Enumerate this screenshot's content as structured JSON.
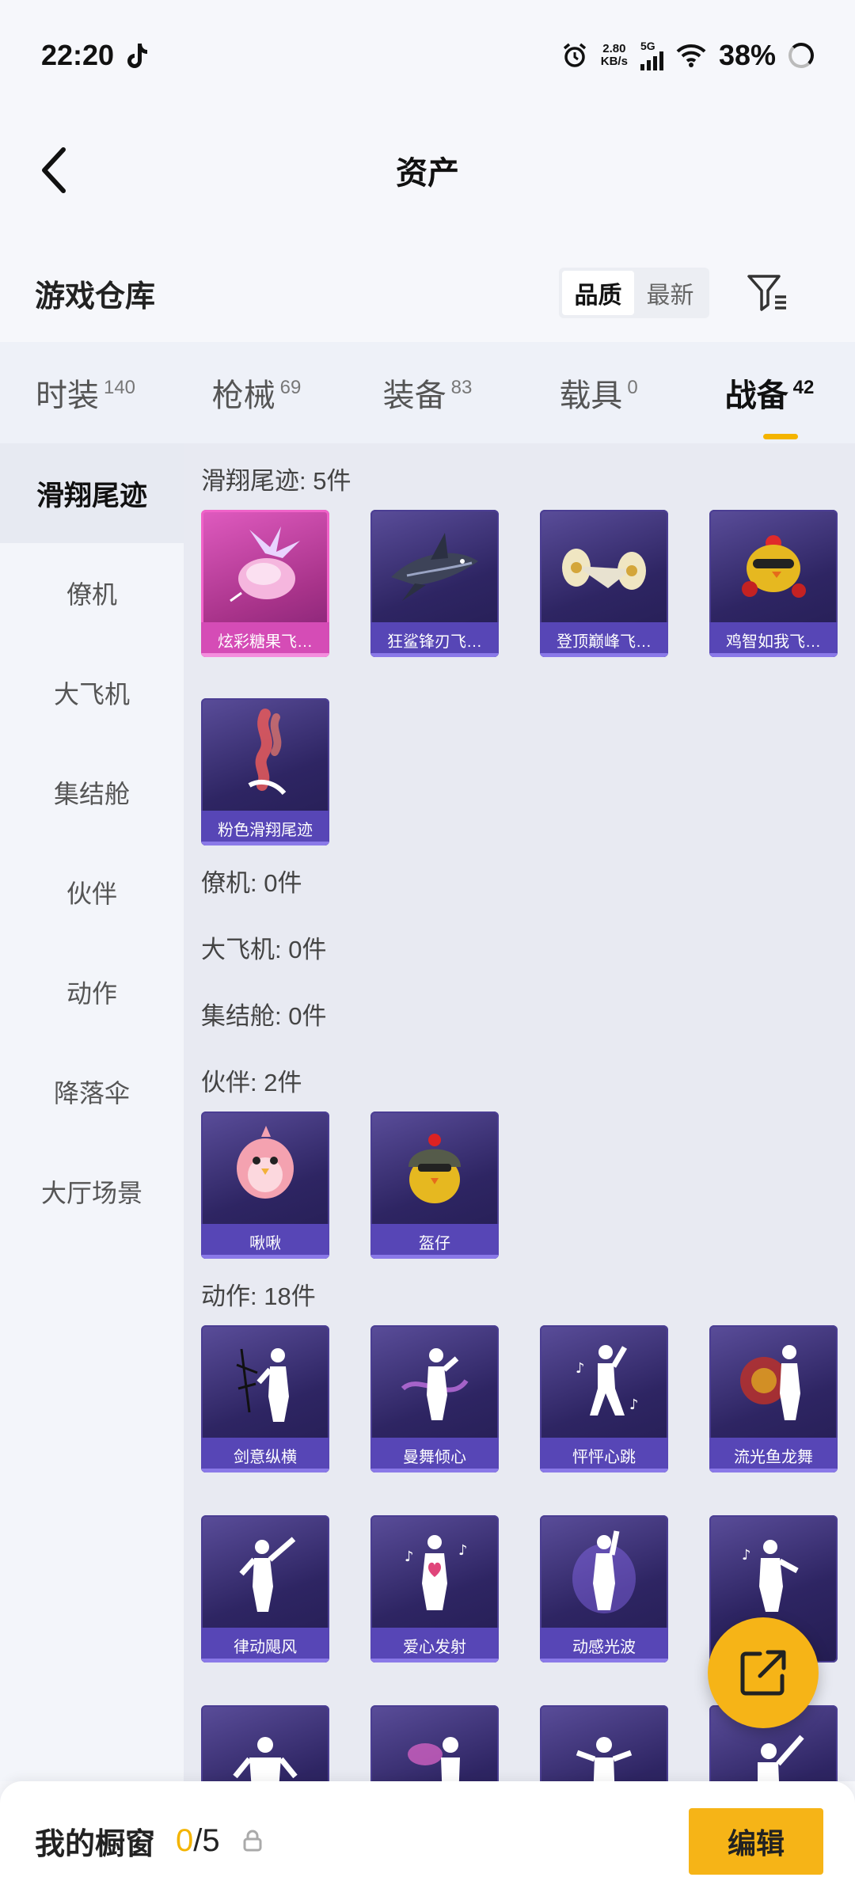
{
  "status_bar": {
    "time": "22:20",
    "net_speed_value": "2.80",
    "net_speed_unit": "KB/s",
    "network": "5G",
    "battery": "38%"
  },
  "header": {
    "title": "资产"
  },
  "warehouse": {
    "title": "游戏仓库",
    "sort_options": [
      "品质",
      "最新"
    ],
    "active_sort": "品质"
  },
  "tabs": [
    {
      "label": "时装",
      "count": "140"
    },
    {
      "label": "枪械",
      "count": "69"
    },
    {
      "label": "装备",
      "count": "83"
    },
    {
      "label": "载具",
      "count": "0"
    },
    {
      "label": "战备",
      "count": "42",
      "active": true
    }
  ],
  "sidebar": {
    "items": [
      "滑翔尾迹",
      "僚机",
      "大飞机",
      "集结舱",
      "伙伴",
      "动作",
      "降落伞",
      "大厅场景"
    ],
    "active": "滑翔尾迹"
  },
  "sections": {
    "trail": {
      "title": "滑翔尾迹: 5件",
      "items": [
        "炫彩糖果飞…",
        "狂鲨锋刃飞…",
        "登顶巅峰飞…",
        "鸡智如我飞…",
        "粉色滑翔尾迹"
      ]
    },
    "wingman": {
      "title": "僚机: 0件"
    },
    "bigplane": {
      "title": "大飞机: 0件"
    },
    "capsule": {
      "title": "集结舱: 0件"
    },
    "partner": {
      "title": "伙伴: 2件",
      "items": [
        "啾啾",
        "盔仔"
      ]
    },
    "emote": {
      "title": "动作: 18件",
      "items": [
        "剑意纵横",
        "曼舞倾心",
        "怦怦心跳",
        "流光鱼龙舞",
        "律动飓风",
        "爱心发射",
        "动感光波"
      ]
    }
  },
  "bottom_bar": {
    "label": "我的橱窗",
    "used": "0",
    "total": "/5",
    "edit_label": "编辑"
  },
  "colors": {
    "accent": "#f6b417",
    "card_label": "#5746b6",
    "card_pink": "#d54cb6"
  }
}
